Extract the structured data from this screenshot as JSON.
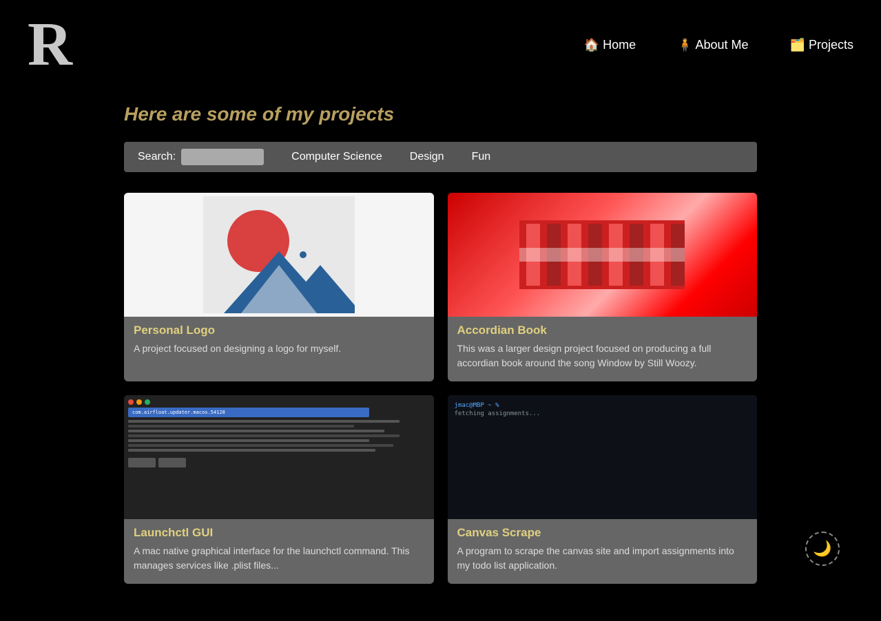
{
  "logo": {
    "text": "R"
  },
  "nav": {
    "items": [
      {
        "id": "home",
        "emoji": "🏠",
        "label": "Home"
      },
      {
        "id": "about",
        "emoji": "🧍",
        "label": "About Me"
      },
      {
        "id": "projects",
        "emoji": "🗂️",
        "label": "Projects"
      }
    ]
  },
  "page": {
    "title": "Here are some of my projects"
  },
  "filterBar": {
    "search_label": "Search:",
    "search_placeholder": "",
    "filters": [
      {
        "id": "cs",
        "label": "Computer Science"
      },
      {
        "id": "design",
        "label": "Design"
      },
      {
        "id": "fun",
        "label": "Fun"
      }
    ]
  },
  "projects": [
    {
      "id": "personal-logo",
      "title": "Personal Logo",
      "description": "A project focused on designing a logo for myself.",
      "type": "design",
      "image_type": "logo-svg"
    },
    {
      "id": "accordian-book",
      "title": "Accordian Book",
      "description": "This was a larger design project focused on producing a full accordian book around the song Window by Still Woozy.",
      "type": "design",
      "image_type": "accordian"
    },
    {
      "id": "launchctl-gui",
      "title": "Launchctl GUI",
      "description": "A mac native graphical interface for the launchctl command. This manages services like .plist files...",
      "type": "cs",
      "image_type": "launchctl"
    },
    {
      "id": "canvas-scrape",
      "title": "Canvas Scrape",
      "description": "A program to scrape the canvas site and import assignments into my todo list application.",
      "type": "cs",
      "image_type": "canvas"
    }
  ],
  "darkToggle": {
    "emoji": "🌙"
  }
}
